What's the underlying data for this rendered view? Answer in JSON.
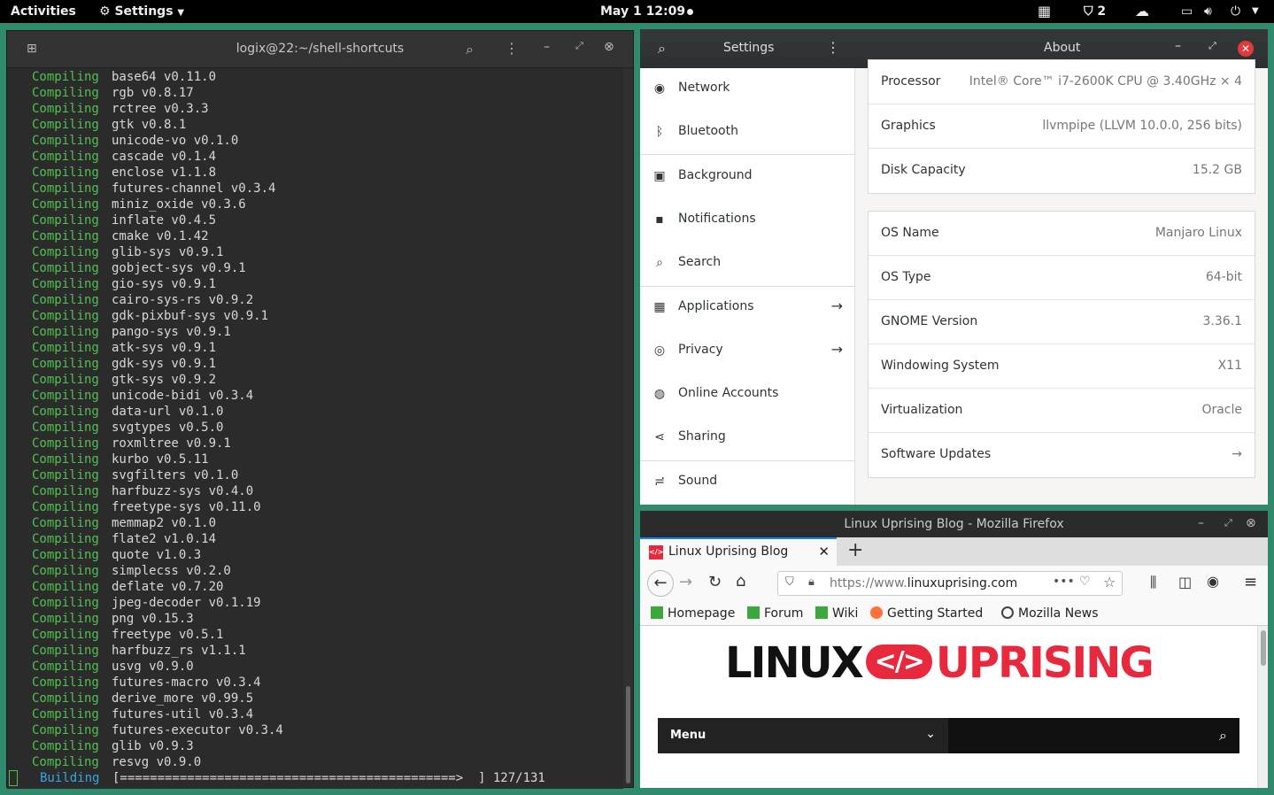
{
  "topbar": {
    "activities": "Activities",
    "settings_label": "Settings",
    "clock": "May 1  12:09",
    "notif_count": "2"
  },
  "terminal": {
    "title": "logix@22:~/shell-shortcuts",
    "compiling_word": "Compiling",
    "lines": [
      "base64 v0.11.0",
      "rgb v0.8.17",
      "rctree v0.3.3",
      "gtk v0.8.1",
      "unicode-vo v0.1.0",
      "cascade v0.1.4",
      "enclose v1.1.8",
      "futures-channel v0.3.4",
      "miniz_oxide v0.3.6",
      "inflate v0.4.5",
      "cmake v0.1.42",
      "glib-sys v0.9.1",
      "gobject-sys v0.9.1",
      "gio-sys v0.9.1",
      "cairo-sys-rs v0.9.2",
      "gdk-pixbuf-sys v0.9.1",
      "pango-sys v0.9.1",
      "atk-sys v0.9.1",
      "gdk-sys v0.9.1",
      "gtk-sys v0.9.2",
      "unicode-bidi v0.3.4",
      "data-url v0.1.0",
      "svgtypes v0.5.0",
      "roxmltree v0.9.1",
      "kurbo v0.5.11",
      "svgfilters v0.1.0",
      "harfbuzz-sys v0.4.0",
      "freetype-sys v0.11.0",
      "memmap2 v0.1.0",
      "flate2 v1.0.14",
      "quote v1.0.3",
      "simplecss v0.2.0",
      "deflate v0.7.20",
      "jpeg-decoder v0.1.19",
      "png v0.15.3",
      "freetype v0.5.1",
      "harfbuzz_rs v1.1.1",
      "usvg v0.9.0",
      "futures-macro v0.3.4",
      "derive_more v0.99.5",
      "futures-util v0.3.4",
      "futures-executor v0.3.4",
      "glib v0.9.3",
      "resvg v0.9.0"
    ],
    "building_word": "Building",
    "building_bar": "[=============================================>  ] 127/131"
  },
  "settings": {
    "title": "Settings",
    "panel_title": "About",
    "nav": [
      {
        "label": "Network",
        "icon": "network-icon"
      },
      {
        "label": "Bluetooth",
        "icon": "bluetooth-icon"
      },
      {
        "label": "Background",
        "icon": "background-icon"
      },
      {
        "label": "Notifications",
        "icon": "notifications-icon"
      },
      {
        "label": "Search",
        "icon": "search-icon"
      },
      {
        "label": "Applications",
        "icon": "applications-icon"
      },
      {
        "label": "Privacy",
        "icon": "privacy-icon"
      },
      {
        "label": "Online Accounts",
        "icon": "online-accounts-icon"
      },
      {
        "label": "Sharing",
        "icon": "sharing-icon"
      },
      {
        "label": "Sound",
        "icon": "sound-icon"
      }
    ],
    "hw": [
      {
        "k": "Processor",
        "v": "Intel® Core™ i7-2600K CPU @ 3.40GHz × 4"
      },
      {
        "k": "Graphics",
        "v": "llvmpipe (LLVM 10.0.0, 256 bits)"
      },
      {
        "k": "Disk Capacity",
        "v": "15.2 GB"
      }
    ],
    "os": [
      {
        "k": "OS Name",
        "v": "Manjaro Linux"
      },
      {
        "k": "OS Type",
        "v": "64-bit"
      },
      {
        "k": "GNOME Version",
        "v": "3.36.1"
      },
      {
        "k": "Windowing System",
        "v": "X11"
      },
      {
        "k": "Virtualization",
        "v": "Oracle"
      },
      {
        "k": "Software Updates",
        "v": "→"
      }
    ]
  },
  "firefox": {
    "title": "Linux Uprising Blog - Mozilla Firefox",
    "tab_label": "Linux Uprising Blog",
    "url_prefix": "https://www.",
    "url_domain": "linuxuprising.com",
    "bookmarks": [
      "Homepage",
      "Forum",
      "Wiki",
      "Getting Started",
      "Mozilla News"
    ],
    "logo_left": "LINUX",
    "logo_mid": "</>",
    "logo_right": "UPRISING",
    "menu_label": "Menu"
  },
  "colors": {
    "terminal_green": "#4ec24e",
    "desktop": "#2f8a6e",
    "logo_red": "#e8283c"
  }
}
